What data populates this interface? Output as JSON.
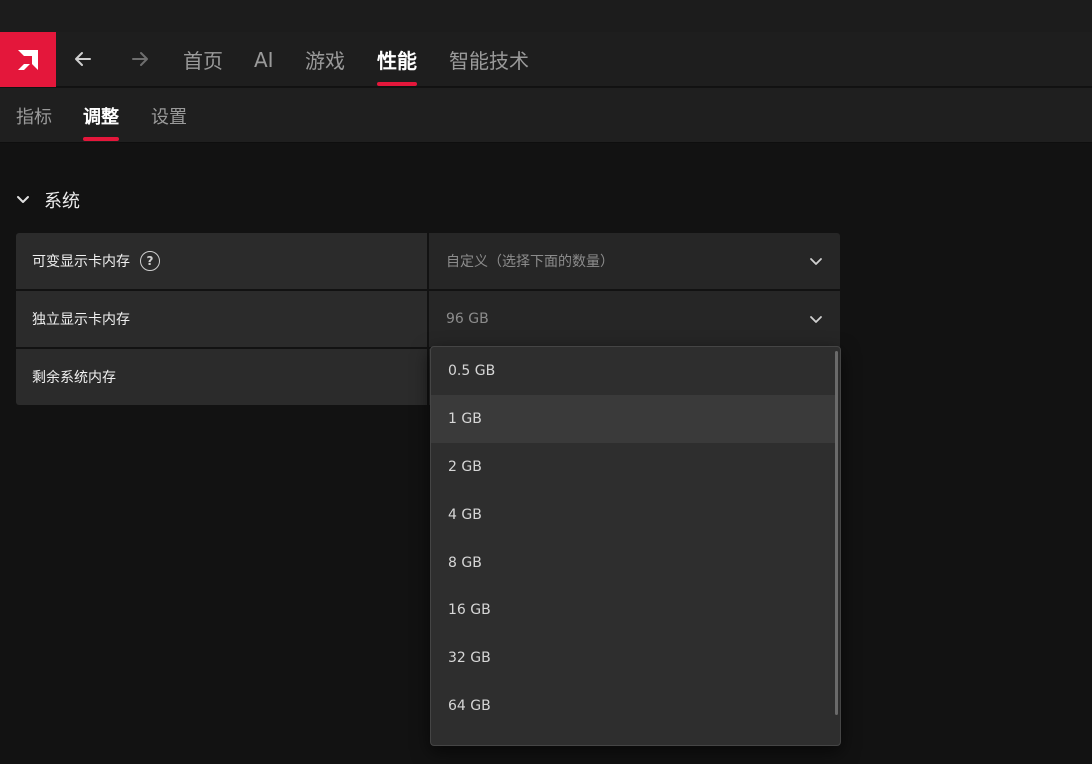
{
  "topnav": {
    "tabs": [
      {
        "label": "首页"
      },
      {
        "label": "AI"
      },
      {
        "label": "游戏"
      },
      {
        "label": "性能"
      },
      {
        "label": "智能技术"
      }
    ],
    "active_tab": "性能"
  },
  "subnav": {
    "tabs": [
      {
        "label": "指标"
      },
      {
        "label": "调整"
      },
      {
        "label": "设置"
      }
    ],
    "active_tab": "调整"
  },
  "section": {
    "title": "系统",
    "rows": [
      {
        "label": "可变显示卡内存",
        "value": "自定义（选择下面的数量）"
      },
      {
        "label": "独立显示卡内存",
        "value": "96 GB"
      },
      {
        "label": "剩余系统内存",
        "value": ""
      }
    ]
  },
  "dropdown": {
    "options": [
      "0.5 GB",
      "1 GB",
      "2 GB",
      "4 GB",
      "8 GB",
      "16 GB",
      "32 GB",
      "64 GB"
    ],
    "hovered": "1 GB"
  },
  "colors": {
    "accent": "#e4173b",
    "background": "#121212"
  }
}
